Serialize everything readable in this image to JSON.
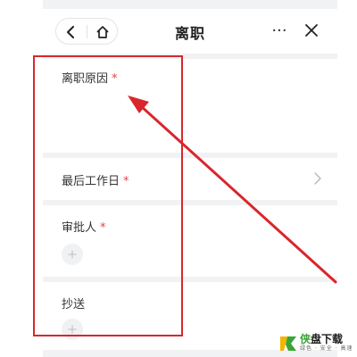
{
  "nav": {
    "title": "离职",
    "more_label": "···"
  },
  "form": {
    "reason": {
      "label": "离职原因",
      "required_mark": "*",
      "value": ""
    },
    "last_day": {
      "label": "最后工作日",
      "required_mark": "*"
    },
    "approver": {
      "label": "审批人",
      "required_mark": "*"
    },
    "cc": {
      "label": "抄送"
    }
  },
  "watermark": {
    "brand_accent": "侠",
    "brand_rest": "盘下载",
    "slogan": "绿色 · 安全 · 高速"
  },
  "colors": {
    "required": "#e64340",
    "annotation": "#d9262c",
    "page_bg": "#f1f2f4",
    "watermark_green": "#3aa535"
  },
  "icons": {
    "back": "chevron-left-icon",
    "home": "home-icon",
    "more": "more-dots-icon",
    "close": "close-icon",
    "chevron": "chevron-right-icon",
    "add": "plus-icon"
  }
}
